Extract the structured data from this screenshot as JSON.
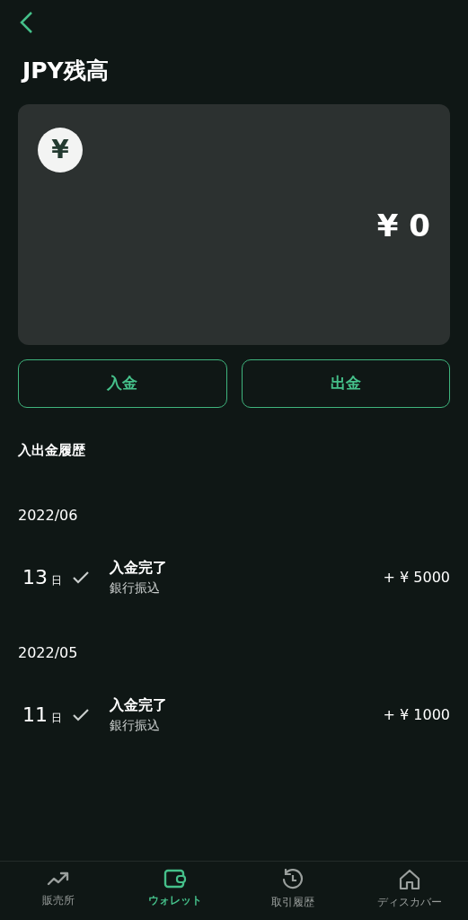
{
  "header": {
    "title": "JPY残高"
  },
  "balance": {
    "currency_symbol": "¥",
    "amount": "¥ 0"
  },
  "actions": [
    "入金",
    "出金"
  ],
  "history": {
    "title": "入出金履歴",
    "groups": [
      {
        "month": "2022/06",
        "items": [
          {
            "day": "13",
            "day_unit": "日",
            "done": true,
            "status": "入金完了",
            "method": "銀行振込",
            "amount": "+ ¥ 5000"
          }
        ]
      },
      {
        "month": "2022/05",
        "items": [
          {
            "day": "11",
            "day_unit": "日",
            "done": true,
            "status": "入金完了",
            "method": "銀行振込",
            "amount": "+ ¥ 1000"
          }
        ]
      }
    ]
  },
  "bottom_nav": [
    {
      "kind": "chart",
      "label": "販売所",
      "selected": false
    },
    {
      "kind": "wallet",
      "label": "ウォレット",
      "selected": true
    },
    {
      "kind": "history",
      "label": "取引履歴",
      "selected": false
    },
    {
      "kind": "home",
      "label": "ディスカバー",
      "selected": false
    }
  ]
}
